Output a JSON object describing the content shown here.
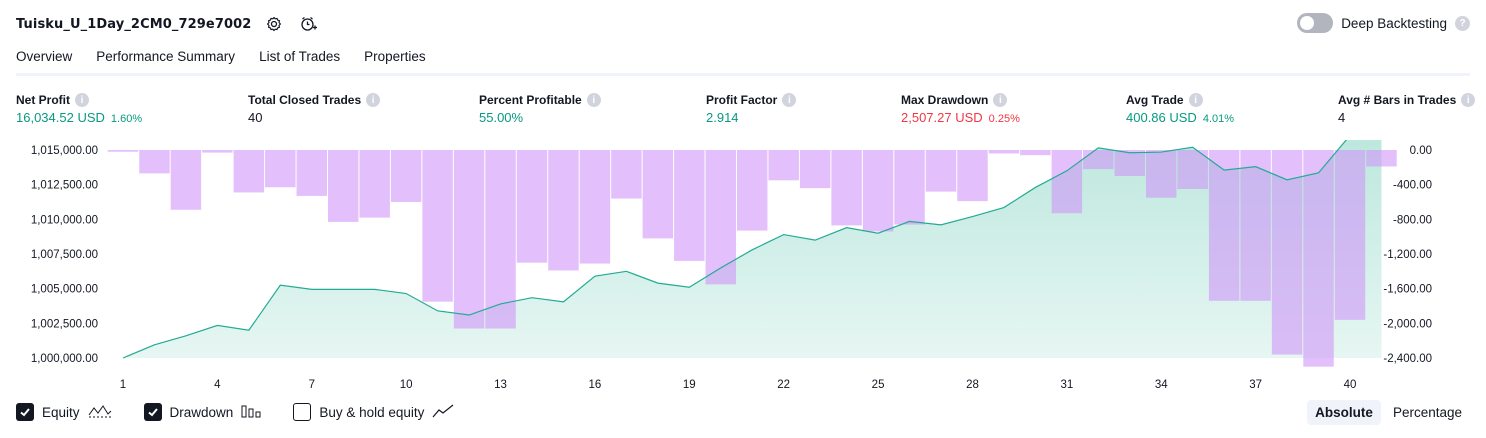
{
  "header": {
    "strategy_title": "Tuisku_U_1Day_2CM0_729e7002",
    "settings_icon": "gear-icon",
    "alert_icon": "add-alert-icon",
    "deep_backtesting_label": "Deep Backtesting",
    "deep_backtesting_on": false
  },
  "tabs": [
    {
      "label": "Overview",
      "active": true
    },
    {
      "label": "Performance Summary",
      "active": false
    },
    {
      "label": "List of Trades",
      "active": false
    },
    {
      "label": "Properties",
      "active": false
    }
  ],
  "metrics": {
    "net_profit": {
      "label": "Net Profit",
      "value": "16,034.52 USD",
      "sub": "1.60%"
    },
    "total_closed_trades": {
      "label": "Total Closed Trades",
      "value": "40"
    },
    "percent_profitable": {
      "label": "Percent Profitable",
      "value": "55.00%"
    },
    "profit_factor": {
      "label": "Profit Factor",
      "value": "2.914"
    },
    "max_drawdown": {
      "label": "Max Drawdown",
      "value": "2,507.27 USD",
      "sub": "0.25%"
    },
    "avg_trade": {
      "label": "Avg Trade",
      "value": "400.86 USD",
      "sub": "4.01%"
    },
    "avg_bars": {
      "label": "Avg # Bars in Trades",
      "value": "4"
    }
  },
  "colors": {
    "equity_line": "#22ab94",
    "equity_fill": "#b9e6dc",
    "drawdown_bar": "#ce93f8",
    "positive": "#089981",
    "negative": "#f23645"
  },
  "chart_data": {
    "type": "line",
    "x_ticks": [
      "1",
      "4",
      "7",
      "10",
      "13",
      "16",
      "19",
      "22",
      "25",
      "28",
      "31",
      "34",
      "37",
      "40"
    ],
    "left_axis_ticks": [
      "1,015,000.00",
      "1,012,500.00",
      "1,010,000.00",
      "1,007,500.00",
      "1,005,000.00",
      "1,002,500.00",
      "1,000,000.00"
    ],
    "right_axis_ticks": [
      "0.00",
      "-400.00",
      "-800.00",
      "-1,200.00",
      "-1,600.00",
      "-2,000.00",
      "-2,400.00"
    ],
    "left_ylim": [
      1000000,
      1015000
    ],
    "right_ylim": [
      -2400,
      0
    ],
    "x": [
      1,
      2,
      3,
      4,
      5,
      6,
      7,
      8,
      9,
      10,
      11,
      12,
      13,
      14,
      15,
      16,
      17,
      18,
      19,
      20,
      21,
      22,
      23,
      24,
      25,
      26,
      27,
      28,
      29,
      30,
      31,
      32,
      33,
      34,
      35,
      36,
      37,
      38,
      39,
      40,
      41
    ],
    "series": [
      {
        "name": "Equity",
        "axis": "left",
        "values": [
          1000000,
          1000950,
          1001600,
          1002350,
          1002000,
          1005250,
          1004950,
          1004950,
          1004950,
          1004650,
          1003400,
          1003100,
          1003900,
          1004350,
          1004050,
          1005900,
          1006250,
          1005400,
          1005100,
          1006500,
          1007800,
          1008900,
          1008500,
          1009400,
          1009000,
          1009850,
          1009600,
          1010200,
          1010850,
          1012300,
          1013500,
          1015150,
          1014800,
          1014850,
          1015200,
          1013550,
          1013800,
          1012850,
          1013350,
          1016050,
          1016000
        ]
      },
      {
        "name": "Drawdown",
        "axis": "right",
        "type": "bar",
        "values": [
          -20,
          -270,
          -690,
          -30,
          -490,
          -430,
          -530,
          -830,
          -780,
          -600,
          -1750,
          -2060,
          -2060,
          -1300,
          -1390,
          -1310,
          -560,
          -1020,
          -1280,
          -1550,
          -930,
          -350,
          -440,
          -870,
          -940,
          -860,
          -480,
          -590,
          -40,
          -60,
          -730,
          -220,
          -300,
          -550,
          -450,
          -1740,
          -1740,
          -2360,
          -2500,
          -1960,
          -190
        ]
      }
    ],
    "grid": false,
    "legend": "bottom-left"
  },
  "footer": {
    "equity_label": "Equity",
    "equity_checked": true,
    "drawdown_label": "Drawdown",
    "drawdown_checked": true,
    "buyhold_label": "Buy & hold equity",
    "buyhold_checked": false,
    "absolute_label": "Absolute",
    "percentage_label": "Percentage",
    "mode": "Absolute"
  }
}
